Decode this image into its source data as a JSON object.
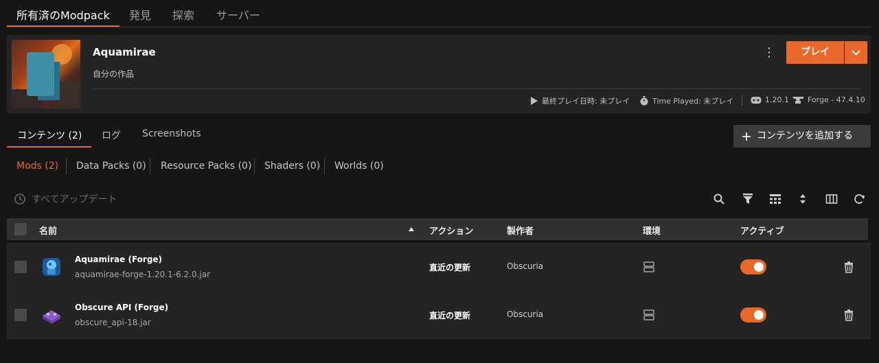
{
  "top_nav": {
    "tabs": [
      "所有済のModpack",
      "発見",
      "探索",
      "サーバー"
    ]
  },
  "pack": {
    "title": "Aquamirae",
    "subtitle": "自分の作品",
    "play_label": "プレイ",
    "last_played": "最終プレイ日時: 未プレイ",
    "time_played": "Time Played: 未プレイ",
    "version": "1.20.1",
    "loader": "Forge - 47.4.10"
  },
  "content_tabs": [
    "コンテンツ (2)",
    "ログ",
    "Screenshots"
  ],
  "add_content_label": "コンテンツを追加する",
  "filters": [
    "Mods (2)",
    "Data Packs (0)",
    "Resource Packs (0)",
    "Shaders (0)",
    "Worlds (0)"
  ],
  "update_all_label": "すべてアップデート",
  "table": {
    "headers": {
      "name": "名前",
      "action": "アクション",
      "author": "製作者",
      "env": "環境",
      "active": "アクティブ"
    },
    "rows": [
      {
        "name": "Aquamirae (Forge)",
        "file": "aquamirae-forge-1.20.1-6.2.0.jar",
        "action": "直近の更新",
        "author": "Obscuria",
        "active": true
      },
      {
        "name": "Obscure API (Forge)",
        "file": "obscure_api-18.jar",
        "action": "直近の更新",
        "author": "Obscuria",
        "active": true
      }
    ]
  },
  "colors": {
    "accent": "#e8692b",
    "background": "#161616",
    "panel": "#242424"
  }
}
